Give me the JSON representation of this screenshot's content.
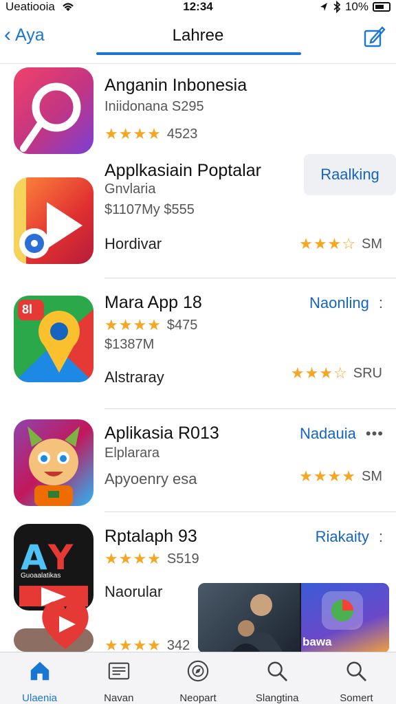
{
  "status_bar": {
    "carrier": "Ueatiooia",
    "time": "12:34",
    "battery_text": "10%"
  },
  "nav": {
    "back_label": "Aya",
    "title": "Lahree"
  },
  "ranking_button": "Raalking",
  "apps": [
    {
      "name": "Anganin Inbonesia",
      "subtitle": "Iniidonana S295",
      "stars": "★★★★",
      "rating": "4523",
      "icon": "chat-bubble-icon"
    },
    {
      "name": "Applkasiain Poptalar",
      "category": "Gnvlaria",
      "price": "$1107My $555",
      "developer": "Hordivar",
      "stars": "★★★☆",
      "rating_count": "SM",
      "icon": "music-play-icon"
    },
    {
      "name": "Mara App 18",
      "action": "Naonling",
      "stars": "★★★★",
      "rating": "$475",
      "price": "$1387M",
      "developer": "Alstraray",
      "right_stars": "★★★☆",
      "rating_count": "SRU",
      "icon": "map-pin-icon",
      "badge": "8l"
    },
    {
      "name": "Aplikasia R013",
      "action": "Nadauia",
      "category": "Elplarara",
      "developer": "Apyoenry esa",
      "stars": "★★★★",
      "rating_count": "SM",
      "icon": "cartoon-character-icon"
    },
    {
      "name": "Rptalaph 93",
      "action": "Riakaity",
      "stars": "★★★★",
      "rating": "S519",
      "developer": "Naorular",
      "icon": "ay-logo-icon",
      "icon_caption": "Guoaalatikas"
    },
    {
      "stars": "★★★★",
      "rating": "342",
      "icon": "heart-play-icon"
    }
  ],
  "promo_caption": "bawa",
  "tabs": [
    {
      "label": "Ulaenia",
      "icon": "home-icon"
    },
    {
      "label": "Navan",
      "icon": "news-icon"
    },
    {
      "label": "Neopart",
      "icon": "compass-icon"
    },
    {
      "label": "Slangtina",
      "icon": "search-icon"
    },
    {
      "label": "Somert",
      "icon": "search-icon"
    }
  ],
  "colors": {
    "accent": "#1976d2",
    "star": "#f5a623"
  }
}
